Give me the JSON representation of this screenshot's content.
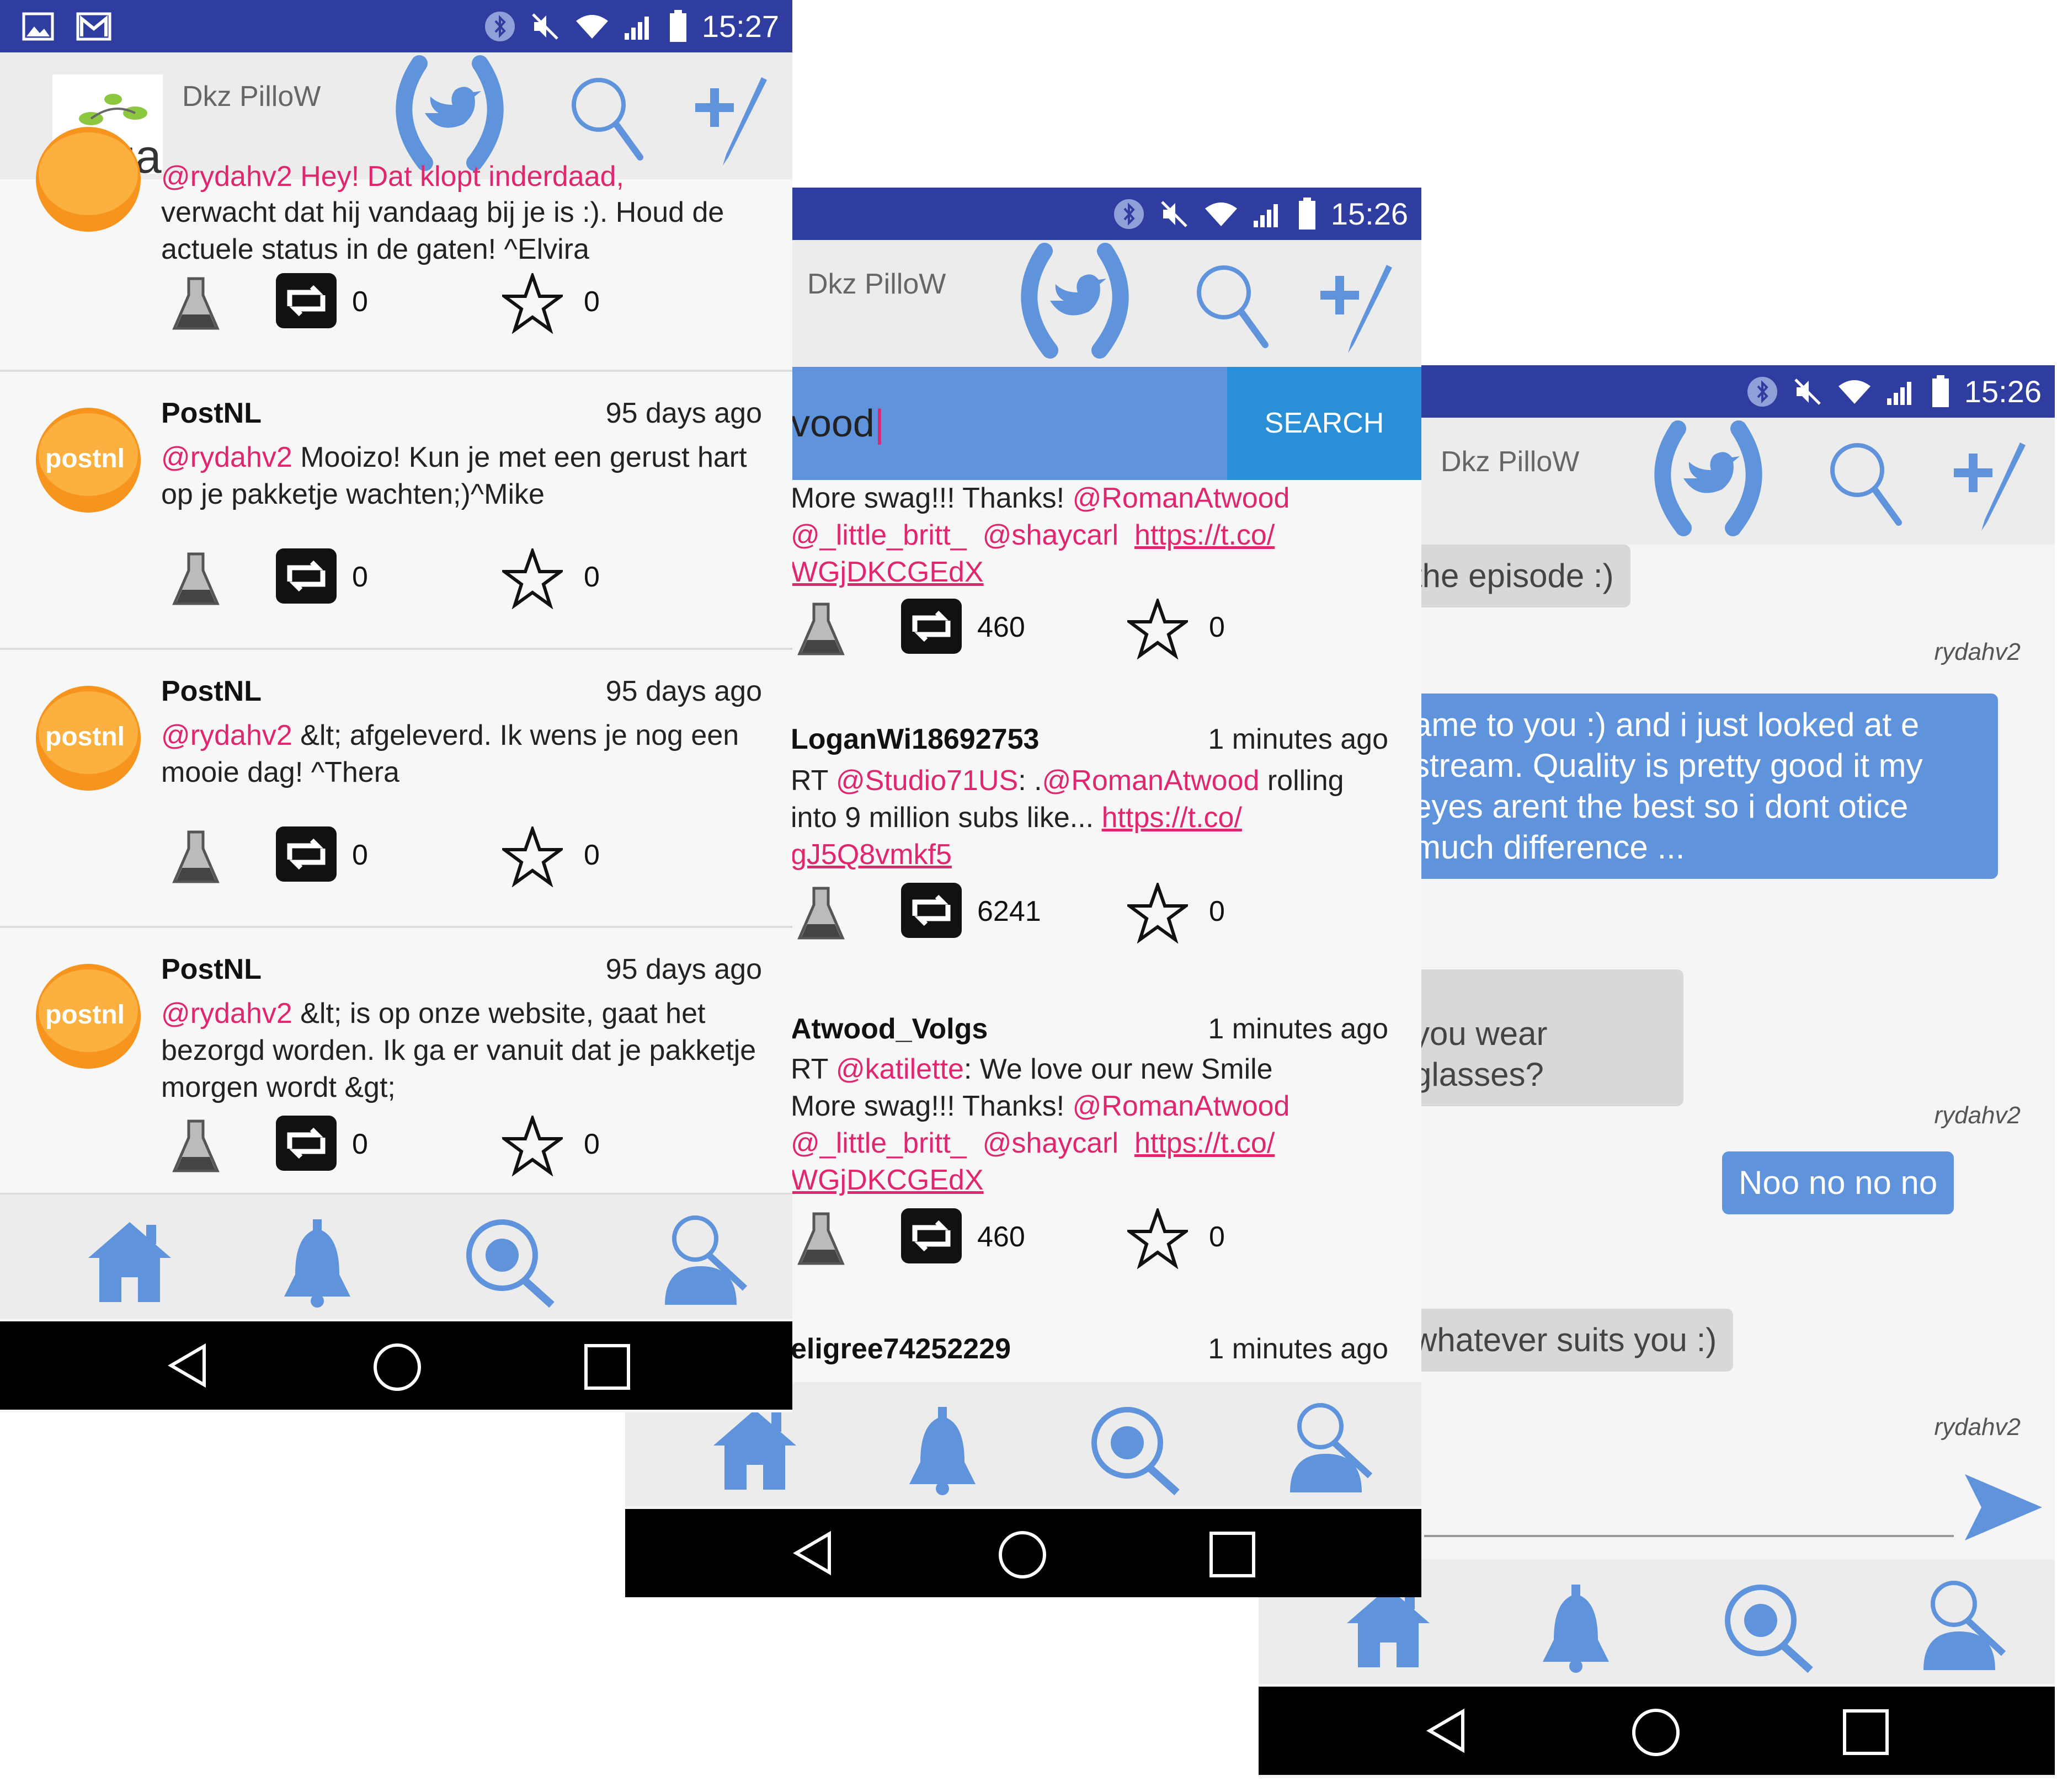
{
  "app": {
    "title": "Dkz PilloW"
  },
  "screen1": {
    "status_time": "15:27",
    "partial_tweet": {
      "text_top": "@rydahv2 Hey! Dat klopt inderdaad,",
      "text": "verwacht dat hij vandaag bij je is :). Houd de actuele status in de gaten! ^Elvira",
      "retweets": "0",
      "likes": "0"
    },
    "tweets": [
      {
        "name": "PostNL",
        "time": "95 days ago",
        "mention": "@rydahv2",
        "text": " Mooizo! Kun je met een gerust hart op je pakketje wachten;)^Mike",
        "retweets": "0",
        "likes": "0"
      },
      {
        "name": "PostNL",
        "time": "95 days ago",
        "mention": "@rydahv2",
        "text": " &lt; afgeleverd. Ik wens je nog een mooie dag! ^Thera",
        "retweets": "0",
        "likes": "0"
      },
      {
        "name": "PostNL",
        "time": "95 days ago",
        "mention": "@rydahv2",
        "text": " &lt; is op onze website, gaat het bezorgd worden. Ik ga er vanuit dat je pakketje morgen wordt &gt;",
        "retweets": "0",
        "likes": "0"
      }
    ],
    "avatar_label": "postnl",
    "header_avatar_label": "noiza"
  },
  "screen2": {
    "status_time": "15:26",
    "search_value": "vood",
    "search_button": "SEARCH",
    "partial_tweet": {
      "line1_a": "More swag!!! Thanks! ",
      "line1_b": "@RomanAtwood",
      "line2_a": "@_little_britt_",
      "line2_b": "@shaycarl",
      "line2_c": "https://t.co/",
      "line3": "WGjDKCGEdX",
      "retweets": "460",
      "likes": "0"
    },
    "tweets": [
      {
        "name": "LoganWi18692753",
        "time": "1 minutes ago",
        "l1a": "RT ",
        "l1b": "@Studio71US",
        "l1c": ": .",
        "l1d": "@RomanAtwood",
        "l1e": " rolling",
        "l2a": "into 9 million subs like... ",
        "l2b": "https://t.co/",
        "l3": "gJ5Q8vmkf5",
        "retweets": "6241",
        "likes": "0"
      },
      {
        "name": "Atwood_Volgs",
        "time": "1 minutes ago",
        "l1a": "RT ",
        "l1b": "@katilette",
        "l1c": ": We love our new Smile",
        "l2a": "More swag!!! Thanks! ",
        "l2b": "@RomanAtwood",
        "l3a": "@_little_britt_",
        "l3b": "@shaycarl",
        "l3c": "https://t.co/",
        "l4": "WGjDKCGEdX",
        "retweets": "460",
        "likes": "0"
      },
      {
        "name": "eligree74252229",
        "time": "1 minutes ago"
      }
    ]
  },
  "screen3": {
    "status_time": "15:26",
    "messages": [
      {
        "type": "in",
        "text": "the episode :)"
      },
      {
        "type": "sender",
        "text": "rydahv2"
      },
      {
        "type": "out",
        "text": "ame to you :) and i just looked at e stream. Quality is pretty good it my eyes arent the best so i dont otice much difference ..."
      },
      {
        "type": "in",
        "text": "you wear glasses?"
      },
      {
        "type": "sender",
        "text": "rydahv2"
      },
      {
        "type": "out",
        "text": "Noo no no no"
      },
      {
        "type": "in",
        "text": "whatever suits you :)"
      },
      {
        "type": "sender",
        "text": "rydahv2"
      }
    ]
  },
  "colors": {
    "accent": "#5f93dc",
    "statusbar": "#2f3da0",
    "mention": "#e0266e"
  }
}
